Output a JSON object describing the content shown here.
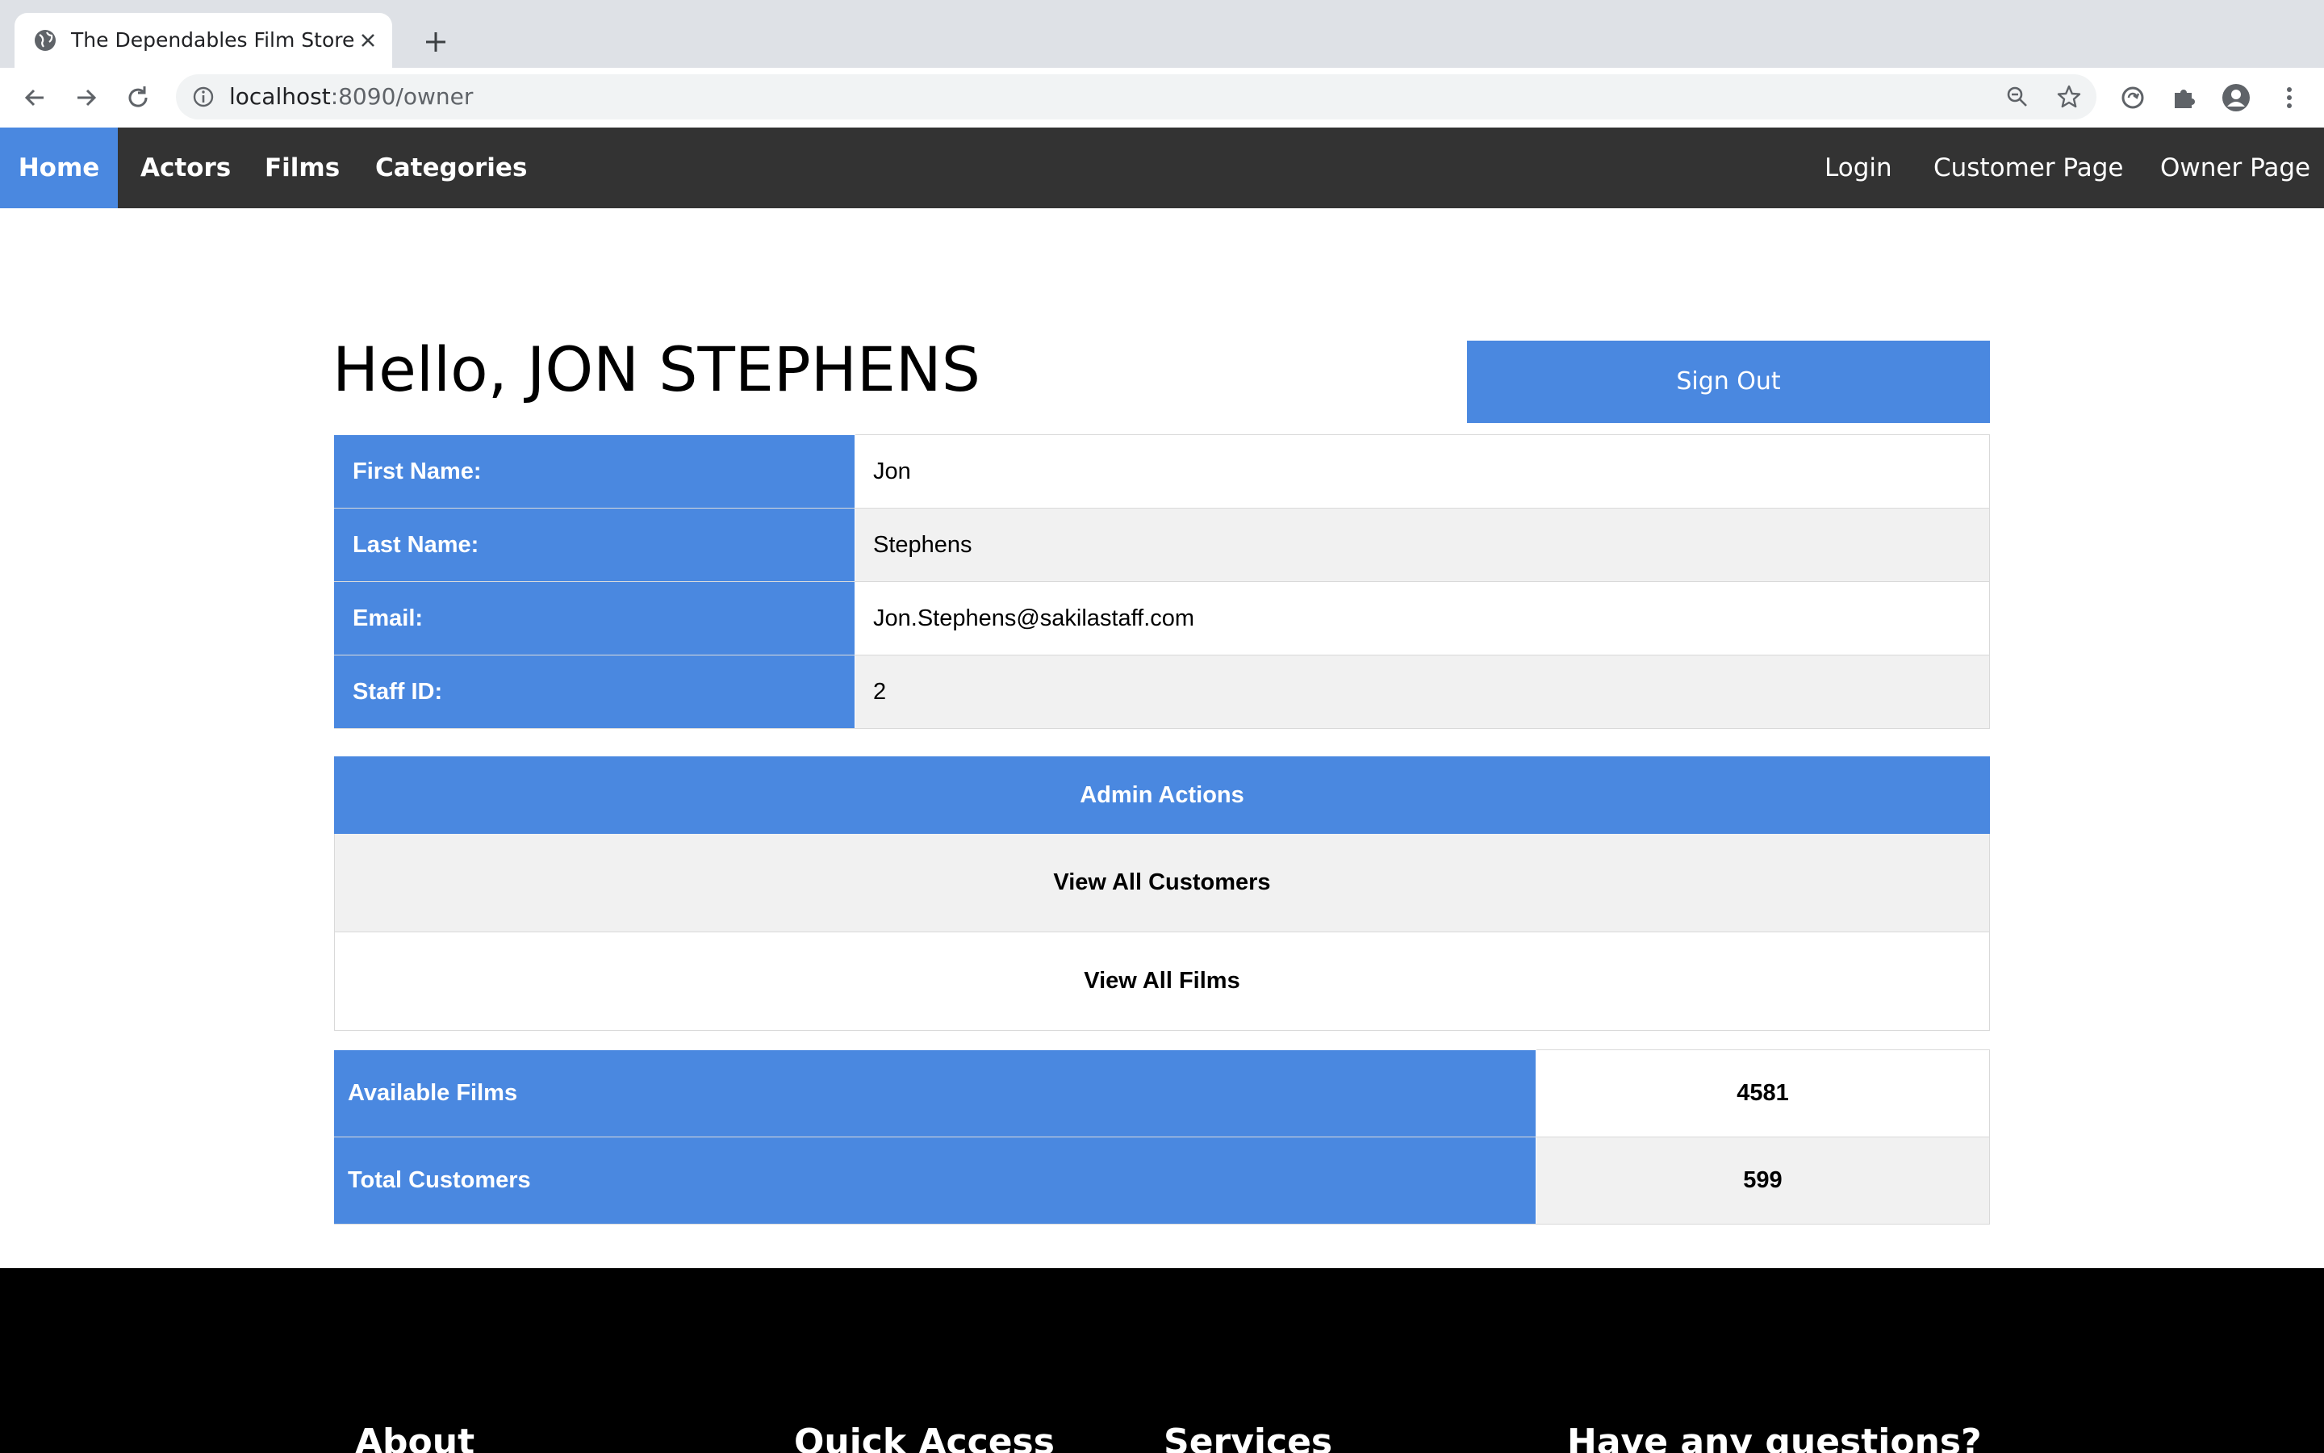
{
  "browser": {
    "tab_title": "The Dependables Film Store",
    "url_host": "localhost",
    "url_rest": ":8090/owner"
  },
  "nav": {
    "left": [
      "Home",
      "Actors",
      "Films",
      "Categories"
    ],
    "right": [
      "Login",
      "Customer Page",
      "Owner Page"
    ],
    "active": "Home"
  },
  "greeting": "Hello, JON STEPHENS",
  "sign_out": "Sign Out",
  "info": [
    {
      "label": "First Name:",
      "value": "Jon"
    },
    {
      "label": "Last Name:",
      "value": "Stephens"
    },
    {
      "label": "Email:",
      "value": "Jon.Stephens@sakilastaff.com"
    },
    {
      "label": "Staff ID:",
      "value": "2"
    }
  ],
  "admin": {
    "heading": "Admin Actions",
    "actions": [
      "View All Customers",
      "View All Films"
    ]
  },
  "stats": [
    {
      "label": "Available Films",
      "value": "4581"
    },
    {
      "label": "Total Customers",
      "value": "599"
    }
  ],
  "footer": {
    "headings": [
      "About",
      "Quick Access",
      "Services",
      "Have any questions?"
    ]
  },
  "colors": {
    "accent": "#4a88e0",
    "nav_bg": "#333333",
    "footer_bg": "#000000"
  }
}
